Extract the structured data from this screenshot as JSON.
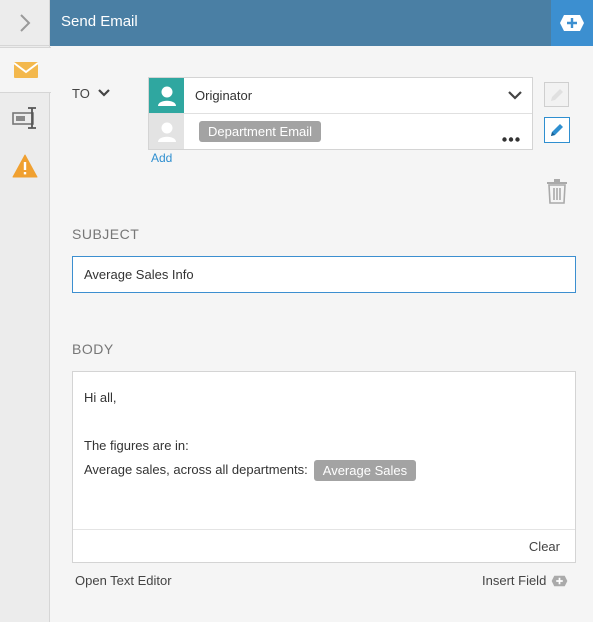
{
  "header": {
    "title": "Send Email",
    "add_icon": "plus-circle-icon"
  },
  "sidebar": {
    "collapse_icon": "chevron-right-icon",
    "tabs": [
      {
        "name": "email",
        "icon": "envelope-icon",
        "active": true
      },
      {
        "name": "text-field",
        "icon": "text-cursor-icon",
        "active": false
      },
      {
        "name": "warning",
        "icon": "warning-icon",
        "active": false
      }
    ]
  },
  "to": {
    "label": "TO",
    "recipients": [
      {
        "text": "Originator",
        "type": "text",
        "avatar_color": "#2fa7a0"
      },
      {
        "text": "Department Email",
        "type": "chip",
        "avatar_color": "#e3e3e3"
      }
    ],
    "add_label": "Add"
  },
  "subject": {
    "label": "SUBJECT",
    "value": "Average Sales Info"
  },
  "body": {
    "label": "BODY",
    "greeting": "Hi all,",
    "line2": "The figures are in:",
    "line3": "Average sales, across all departments:",
    "line3_field": "Average Sales",
    "clear_label": "Clear"
  },
  "footer": {
    "open_editor_label": "Open Text Editor",
    "insert_field_label": "Insert Field"
  },
  "colors": {
    "header_bg": "#4a7fa4",
    "accent": "#3c8fd0",
    "avatar_teal": "#2fa7a0",
    "chip_bg": "#a3a3a3",
    "warning": "#f0a030",
    "envelope": "#f3b84d"
  }
}
